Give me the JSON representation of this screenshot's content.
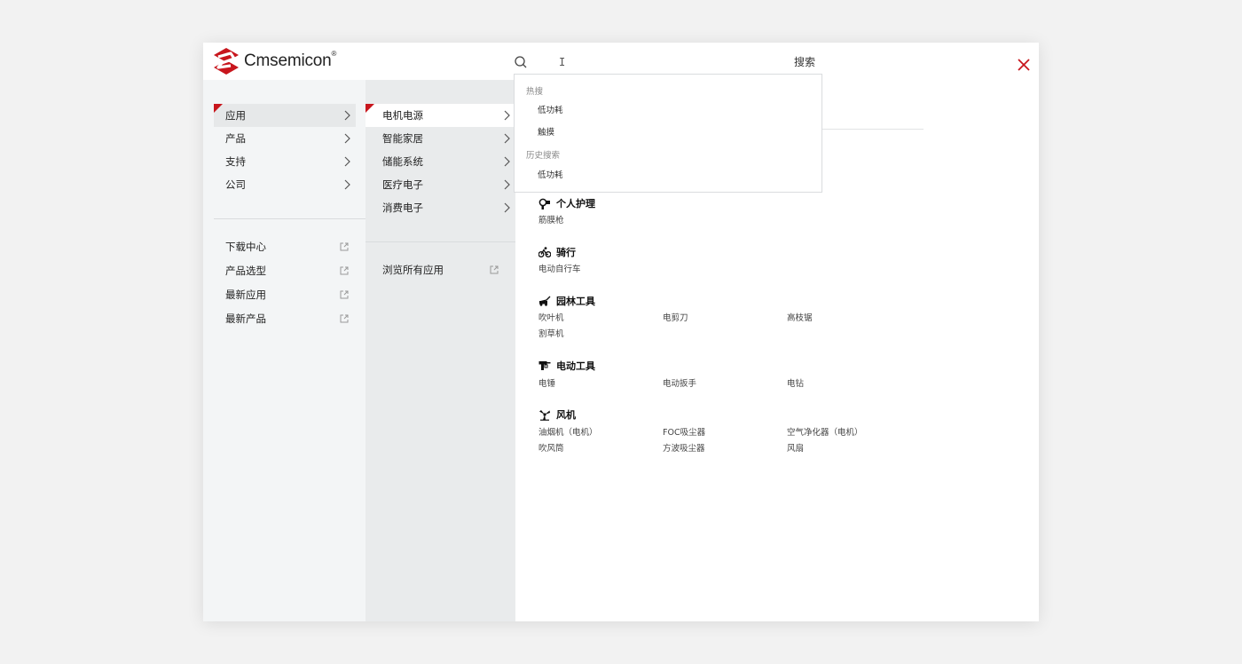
{
  "logo": {
    "text": "Cmsemicon",
    "mark": "®",
    "brand_color": "#c8161d"
  },
  "search": {
    "value": "",
    "placeholder": "",
    "button_label": "搜索"
  },
  "primary_menu": [
    {
      "label": "应用",
      "active": true
    },
    {
      "label": "产品"
    },
    {
      "label": "支持"
    },
    {
      "label": "公司"
    }
  ],
  "quick_links": [
    {
      "label": "下载中心"
    },
    {
      "label": "产品选型"
    },
    {
      "label": "最新应用"
    },
    {
      "label": "最新产品"
    }
  ],
  "secondary_menu": [
    {
      "label": "电机电源",
      "active": true
    },
    {
      "label": "智能家居"
    },
    {
      "label": "储能系统"
    },
    {
      "label": "医疗电子"
    },
    {
      "label": "消费电子"
    }
  ],
  "browse_all": {
    "label": "浏览所有应用"
  },
  "dropdown": {
    "hot_title": "热搜",
    "hot": [
      "低功耗",
      "触摸"
    ],
    "history_title": "历史搜索",
    "history": [
      "低功耗"
    ]
  },
  "categories": [
    {
      "title": "个人护理",
      "icon": "hair-dryer-icon",
      "items": [
        "筋膜枪"
      ]
    },
    {
      "title": "骑行",
      "icon": "bicycle-icon",
      "items": [
        "电动自行车"
      ]
    },
    {
      "title": "园林工具",
      "icon": "lawn-mower-icon",
      "items": [
        "吹叶机",
        "电剪刀",
        "高枝锯",
        "割草机"
      ]
    },
    {
      "title": "电动工具",
      "icon": "drill-icon",
      "items": [
        "电锤",
        "电动扳手",
        "电钻"
      ]
    },
    {
      "title": "风机",
      "icon": "fan-icon",
      "items": [
        "油烟机（电机）",
        "FOC吸尘器",
        "空气净化器（电机）",
        "吹风筒",
        "方波吸尘器",
        "风扇"
      ]
    }
  ]
}
